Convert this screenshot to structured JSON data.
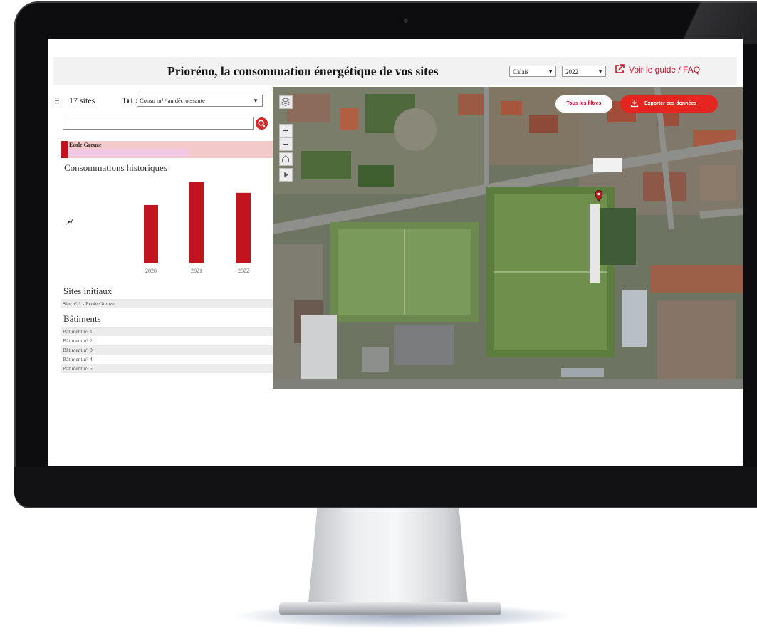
{
  "header": {
    "title": "Prioréno, la consommation énergétique de vos sites",
    "city_select": "Calais",
    "year_select": "2022",
    "guide_link": "Voir le guide / FAQ"
  },
  "sidebar": {
    "site_count": "17 sites",
    "sort_label": "Tri :",
    "sort_value": "Conso m² / an décroissante",
    "search_value": "",
    "selected_site": "Ecole Greuze",
    "history_title": "Consommations historiques",
    "initial_sites_title": "Sites initiaux",
    "initial_sites": [
      "Site n° 1 - Ecole Greuze"
    ],
    "buildings_title": "Bâtiments",
    "buildings": [
      "Bâtiment n° 1",
      "Bâtiment n° 2",
      "Bâtiment n° 3",
      "Bâtiment n° 4",
      "Bâtiment n° 5"
    ]
  },
  "chart_data": {
    "type": "bar",
    "categories": [
      "2020",
      "2021",
      "2022"
    ],
    "values": [
      72,
      100,
      87
    ],
    "title": "Consommations historiques",
    "xlabel": "",
    "ylabel": "",
    "ylim": [
      0,
      100
    ],
    "color": "#c0141e"
  },
  "map": {
    "filters_button": "Tous les filtres",
    "export_button": "Exporter ces données",
    "controls": [
      "layers-icon",
      "zoom-in",
      "zoom-out",
      "home-icon",
      "play-icon"
    ]
  },
  "colors": {
    "accent": "#c8102e",
    "bar": "#c0141e",
    "selected_row": "#f4c9c9"
  }
}
